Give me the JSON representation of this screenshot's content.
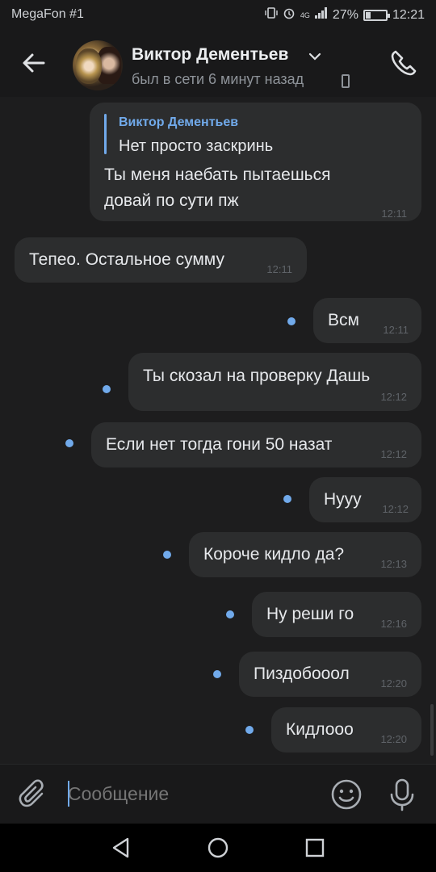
{
  "status_bar": {
    "carrier": "MegaFon #1",
    "net_label": "4G",
    "battery": "27%",
    "battery_level": 0.27,
    "time": "12:21"
  },
  "header": {
    "contact_name": "Виктор Дементьев",
    "status": "был в сети 6 минут назад",
    "back_icon": "arrow-left-icon",
    "call_icon": "phone-icon"
  },
  "messages": [
    {
      "reply": {
        "author": "Виктор Дементьев",
        "text": "Нет просто заскринь"
      },
      "line1": "Ты меня наебать пытаешься",
      "line2": "довай по сути пж",
      "time": "12:11"
    },
    {
      "text": "Тепео. Остальное сумму",
      "time": "12:11"
    },
    {
      "text": "Всм",
      "time": "12:11"
    },
    {
      "text": "Ты скозал на проверку Дашь",
      "time": "12:12"
    },
    {
      "text": "Если нет тогда гони 50 назат",
      "time": "12:12"
    },
    {
      "text": "Нууу",
      "time": "12:12"
    },
    {
      "text": "Короче кидло да?",
      "time": "12:13"
    },
    {
      "text": "Ну реши го",
      "time": "12:16"
    },
    {
      "text": "Пиздобооол",
      "time": "12:20"
    },
    {
      "text": "Кидлооо",
      "time": "12:20"
    }
  ],
  "composer": {
    "placeholder": "Сообщение",
    "attach_icon": "paperclip-icon",
    "emoji_icon": "smile-icon",
    "mic_icon": "microphone-icon"
  },
  "colors": {
    "accent": "#71aaeb",
    "bubble": "#2c2d2e",
    "background": "#1d1d1e"
  }
}
